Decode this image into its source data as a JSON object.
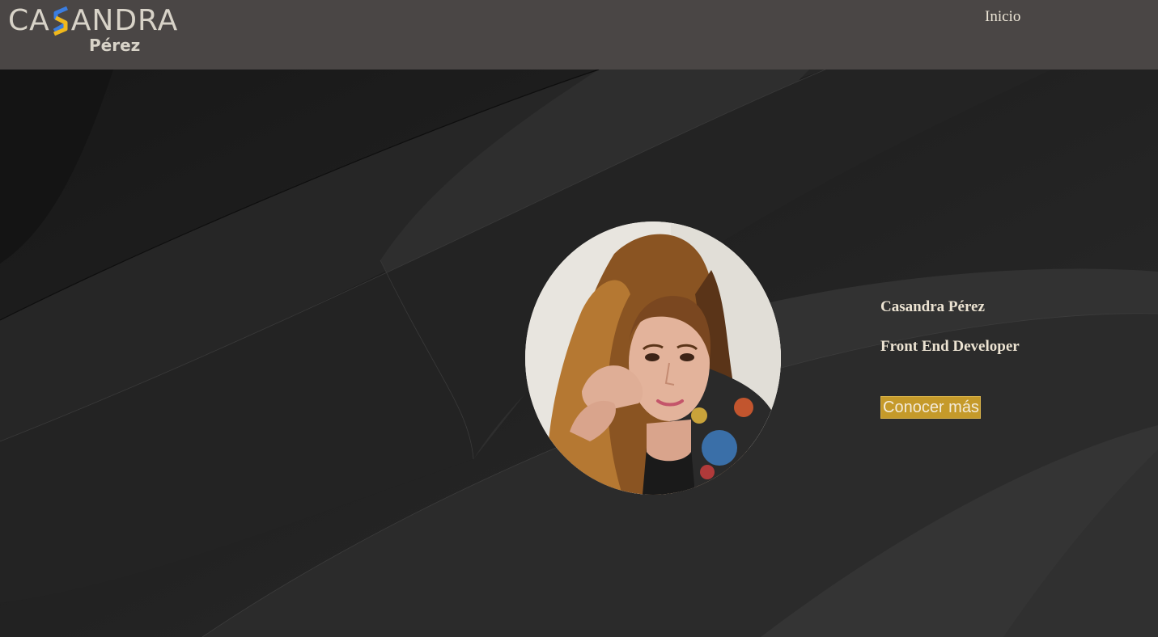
{
  "header": {
    "logo": {
      "top_text": "CASANDRA",
      "bottom_text": "Pérez"
    },
    "nav": {
      "inicio_label": "Inicio"
    }
  },
  "intro": {
    "name": "Casandra Pérez",
    "role": "Front End Developer",
    "cta_label": "Conocer más"
  },
  "colors": {
    "header_bg": "#4a4645",
    "hero_bg": "#1f1f1f",
    "accent": "#c59a2a",
    "logo_blue": "#3a7de0",
    "logo_yellow": "#f0b81c",
    "text_light": "#ece3d2"
  }
}
